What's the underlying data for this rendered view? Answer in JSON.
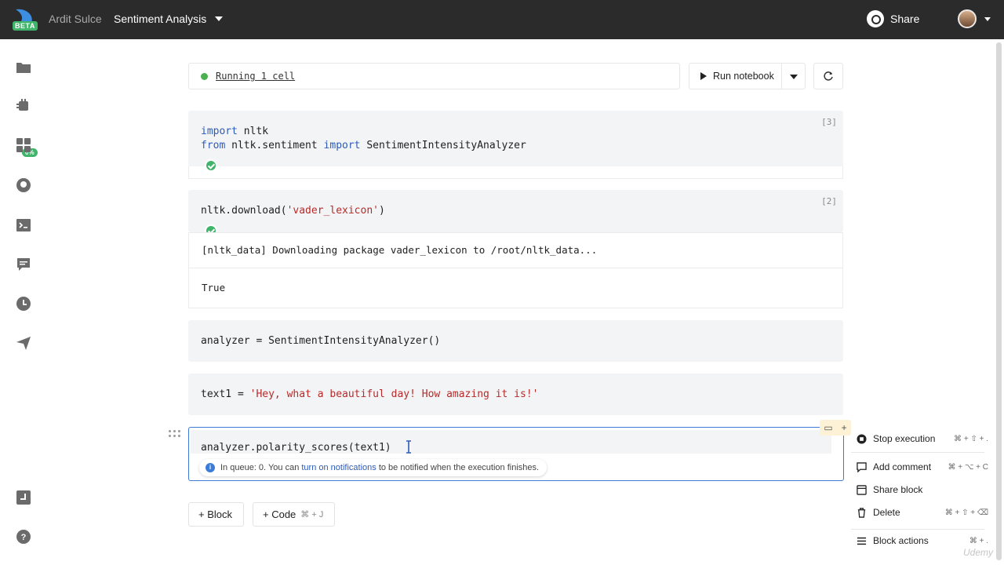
{
  "topbar": {
    "beta": "BETA",
    "owner": "Ardit Sulce",
    "project": "Sentiment Analysis",
    "share_label": "Share"
  },
  "sidebar": {
    "items": [
      "folder-icon",
      "environment-icon",
      "integrations-icon",
      "github-icon",
      "terminal-icon",
      "comments-icon",
      "history-icon",
      "publish-icon",
      "shortcuts-icon",
      "help-icon"
    ],
    "badge": "0%"
  },
  "toolbar": {
    "status_text": "Running 1 cell",
    "run_label": "Run notebook"
  },
  "cells": [
    {
      "exec": "[3]",
      "lines": [
        "import nltk",
        "from nltk.sentiment import SentimentIntensityAnalyzer"
      ]
    },
    {
      "exec": "[2]",
      "code": "nltk.download('vader_lexicon')",
      "output_1": "[nltk_data] Downloading package vader_lexicon to /root/nltk_data...",
      "output_2": "True"
    },
    {
      "code": "analyzer = SentimentIntensityAnalyzer()"
    },
    {
      "code_var": "text1 = ",
      "code_str": "'Hey, what a beautiful day! How amazing it is!'"
    },
    {
      "code": "analyzer.polarity_scores(text1)"
    }
  ],
  "queue": {
    "prefix": "In queue: 0. You can ",
    "link": "turn on notifications",
    "suffix": " to be notified when the execution finishes."
  },
  "add": {
    "block_label": "+ Block",
    "code_label": "+ Code",
    "code_kbd": "⌘ + J"
  },
  "menu": [
    {
      "label": "Stop execution",
      "shortcut": "⌘ + ⇧ + ."
    },
    {
      "label": "Add comment",
      "shortcut": "⌘ + ⌥ + C"
    },
    {
      "label": "Share block",
      "shortcut": ""
    },
    {
      "label": "Delete",
      "shortcut": "⌘ + ⇧ + ⌫"
    },
    {
      "label": "Block actions",
      "shortcut": "⌘ + ."
    }
  ],
  "watermark": "Udemy",
  "colors": {
    "accent": "#3d7bd9",
    "success": "#3fb46a",
    "topbar": "#2b2b2b",
    "keyword": "#2e5bb8",
    "string": "#b82a2a"
  }
}
